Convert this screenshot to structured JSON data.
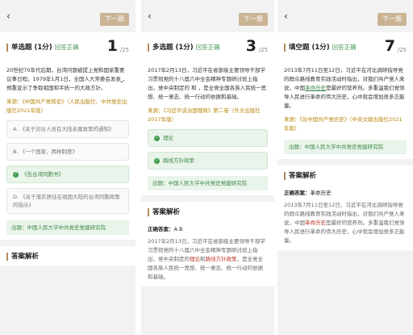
{
  "nav": {
    "back_glyph": "‹",
    "next_label": "下一题"
  },
  "panel1": {
    "qtype": "单选题 (1分)",
    "tag": "回答正确",
    "qnum": "1",
    "qtotal": "/25",
    "stem_a": "20世纪70年代后期，台湾问题被提上党和国家重要议事日程。1979年1月1日，全国人大常委会发表",
    "stem_blank": "       ",
    "stem_b": "，郑重宣示了争取祖国和平统一的大政方针。",
    "src_label": "来源：",
    "src_book": "《中国共产党简史》",
    "src_pub": "（人民出版社、中共党史出版社2021年版）",
    "options": [
      {
        "text": "A. 《关于对台人员在大陆亲属政策的通知》",
        "correct": false
      },
      {
        "text": "B. 《一个国家，两种制度》",
        "correct": false
      },
      {
        "text": "《告台湾同胞书》",
        "correct": true
      },
      {
        "text": "D. 《关于落实居住在祖国大陆的台湾同胞政策的指示》",
        "correct": false
      }
    ],
    "footer": "出题：中国人民大学中共党史党建研究院",
    "analysis_title": "答案解析"
  },
  "panel2": {
    "qtype": "多选题 (1分)",
    "tag": "回答正确",
    "qnum": "3",
    "qtotal": "/25",
    "stem": "2017年2月13日，习近平在省部级主要领导干部学习贯彻党的十八届六中全会精神专题研讨班上指出，党中央制定的       和       ，是全党全国各族人民统一思想、统一意志、统一行动的依据和基础。",
    "src_label": "来源：",
    "src_book": "《习近平谈治国理政》第二卷",
    "src_pub": "（外文出版社2017年版）",
    "options": [
      {
        "text": "理论",
        "correct": true
      },
      {
        "text": "路线方针政策",
        "correct": true
      }
    ],
    "footer": "出题：中国人民大学中共党史党建研究院",
    "analysis_title": "答案解析",
    "answer_label": "正确答案：",
    "answer_value": "A B",
    "exp_a": "2017年2月13日，习近平在省部级主要领导干部学习贯彻党的十八届六中全会精神专题研讨班上指出，党中央制定的",
    "exp_red1": "理论",
    "exp_mid": "和",
    "exp_red2": "路线方针政策",
    "exp_b": "，是全党全国各族人民统一思想、统一意志、统一行动的依据和基础。"
  },
  "panel3": {
    "qtype": "填空题 (1分)",
    "tag": "回答正确",
    "qnum": "7",
    "qtotal": "/25",
    "stem_a": "2013年7月11日至12日，习近平在河北调研指导党的群众路线教育实践活动时指出，对我们共产党人来说，中国",
    "stem_blank": "革命历史",
    "stem_b": "是最好的营养剂。多重温我们党领导人民进行革命的伟大历史，心中就会增加很多正能量。",
    "src_label": "来源：",
    "src_book": "《论中国共产党历史》",
    "src_pub": "（中央文献出版社2021年版）",
    "footer": "出题：中国人民大学中共党史党建研究院",
    "analysis_title": "答案解析",
    "answer_label": "正确答案：",
    "answer_value": "革命历史",
    "exp_a": "2013年7月11日至12日，习近平在河北调研指导党的群众路线教育实践活动时指出，对我们共产党人来说，中国",
    "exp_red": "革命历史",
    "exp_b": "是最好的营养剂。多重温我们党领导人民进行革命的伟大历史，心中就会增加很多正能量。"
  },
  "colors": {
    "accent": "#c9b393",
    "correct_green": "#3e8a4a",
    "source_gold": "#b8860b",
    "highlight_red": "#c0392b"
  }
}
